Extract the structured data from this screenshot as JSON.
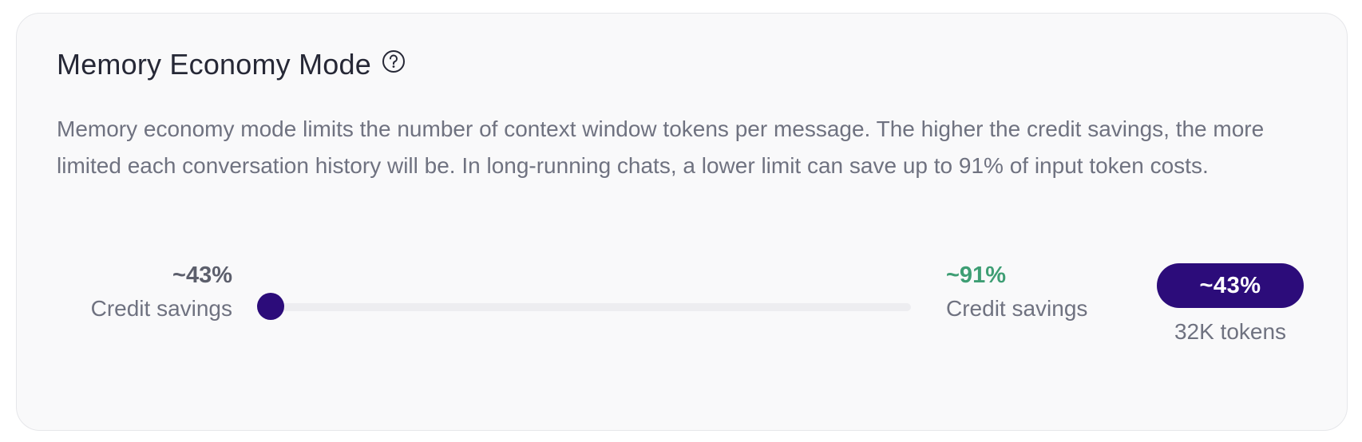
{
  "card": {
    "title": "Memory Economy Mode",
    "help_icon": "question-circle-icon",
    "description": "Memory economy mode limits the number of context window tokens per message. The higher the credit savings, the more limited each conversation history will be. In long-running chats, a lower limit can save up to 91% of input token costs."
  },
  "slider": {
    "min_label_value": "~43%",
    "min_label_caption": "Credit savings",
    "max_label_value": "~91%",
    "max_label_caption": "Credit savings",
    "position": 0,
    "accent_color": "#2c0c7a",
    "max_color": "#3e9e74"
  },
  "selection": {
    "badge_value": "~43%",
    "tokens_label": "32K tokens"
  }
}
